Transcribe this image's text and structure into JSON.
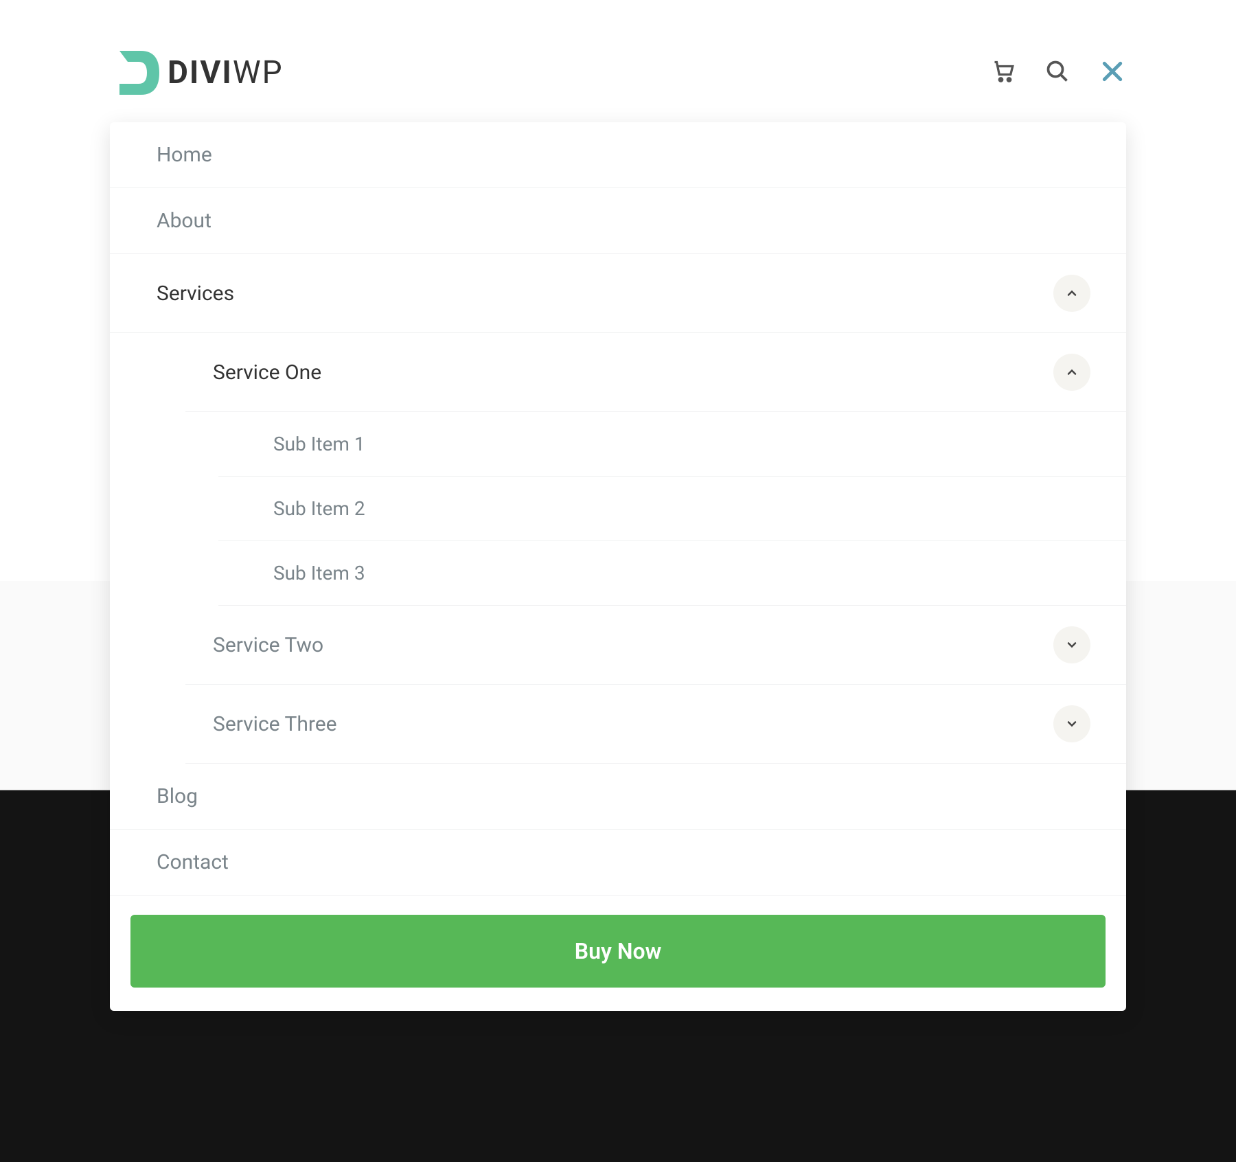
{
  "header": {
    "logo_text_divi": "DIVI",
    "logo_text_wp": "WP"
  },
  "menu": {
    "home": "Home",
    "about": "About",
    "services": "Services",
    "service_one": "Service One",
    "sub_item_1": "Sub Item 1",
    "sub_item_2": "Sub Item 2",
    "sub_item_3": "Sub Item 3",
    "service_two": "Service Two",
    "service_three": "Service Three",
    "blog": "Blog",
    "contact": "Contact"
  },
  "cta": {
    "buy_now": "Buy Now"
  },
  "colors": {
    "accent_green": "#57b857",
    "logo_teal": "#5fc5a8",
    "close_blue": "#5a9eb5"
  }
}
